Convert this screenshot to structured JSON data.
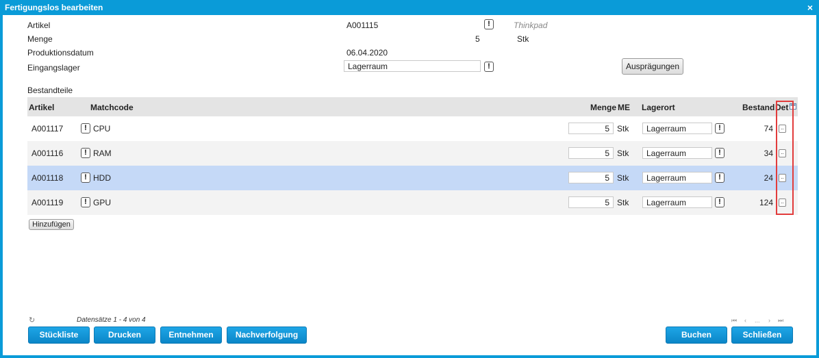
{
  "window": {
    "title": "Fertigungslos bearbeiten",
    "close_glyph": "×"
  },
  "form": {
    "artikel_label": "Artikel",
    "artikel_value": "A001115",
    "artikel_name": "Thinkpad",
    "menge_label": "Menge",
    "menge_value": "5",
    "menge_unit": "Stk",
    "datum_label": "Produktionsdatum",
    "datum_value": "06.04.2020",
    "lager_label": "Eingangslager",
    "lager_value": "Lagerraum",
    "auspraegungen_button": "Ausprägungen"
  },
  "bestandteile": {
    "section_label": "Bestandteile",
    "columns": {
      "artikel": "Artikel",
      "matchcode": "Matchcode",
      "menge": "Menge",
      "me": "ME",
      "lagerort": "Lagerort",
      "bestand": "Bestand",
      "det": "Det"
    },
    "rows": [
      {
        "artikel": "A001117",
        "matchcode": "CPU",
        "menge": "5",
        "me": "Stk",
        "lagerort": "Lagerraum",
        "bestand": "74",
        "det": ".."
      },
      {
        "artikel": "A001116",
        "matchcode": "RAM",
        "menge": "5",
        "me": "Stk",
        "lagerort": "Lagerraum",
        "bestand": "34",
        "det": ".."
      },
      {
        "artikel": "A001118",
        "matchcode": "HDD",
        "menge": "5",
        "me": "Stk",
        "lagerort": "Lagerraum",
        "bestand": "24",
        "det": ".."
      },
      {
        "artikel": "A001119",
        "matchcode": "GPU",
        "menge": "5",
        "me": "Stk",
        "lagerort": "Lagerraum",
        "bestand": "124",
        "det": ".."
      }
    ],
    "add_button": "Hinzufügen",
    "selected_row": 2
  },
  "footer": {
    "status_text": "Datensätze 1 - 4 von 4",
    "pager_dots": "...",
    "buttons": {
      "stueckliste": "Stückliste",
      "drucken": "Drucken",
      "entnehmen": "Entnehmen",
      "nachverfolgung": "Nachverfolgung",
      "buchen": "Buchen",
      "schliessen": "Schließen"
    }
  },
  "icons": {
    "excl": "!",
    "refresh": "↻",
    "pager_first": "⏮",
    "pager_prev": "‹",
    "pager_next": "›",
    "pager_last": "⏭"
  },
  "colors": {
    "accent": "#0a9bd8",
    "selected_row": "#c5d9f7",
    "highlight": "#e23b3b"
  }
}
